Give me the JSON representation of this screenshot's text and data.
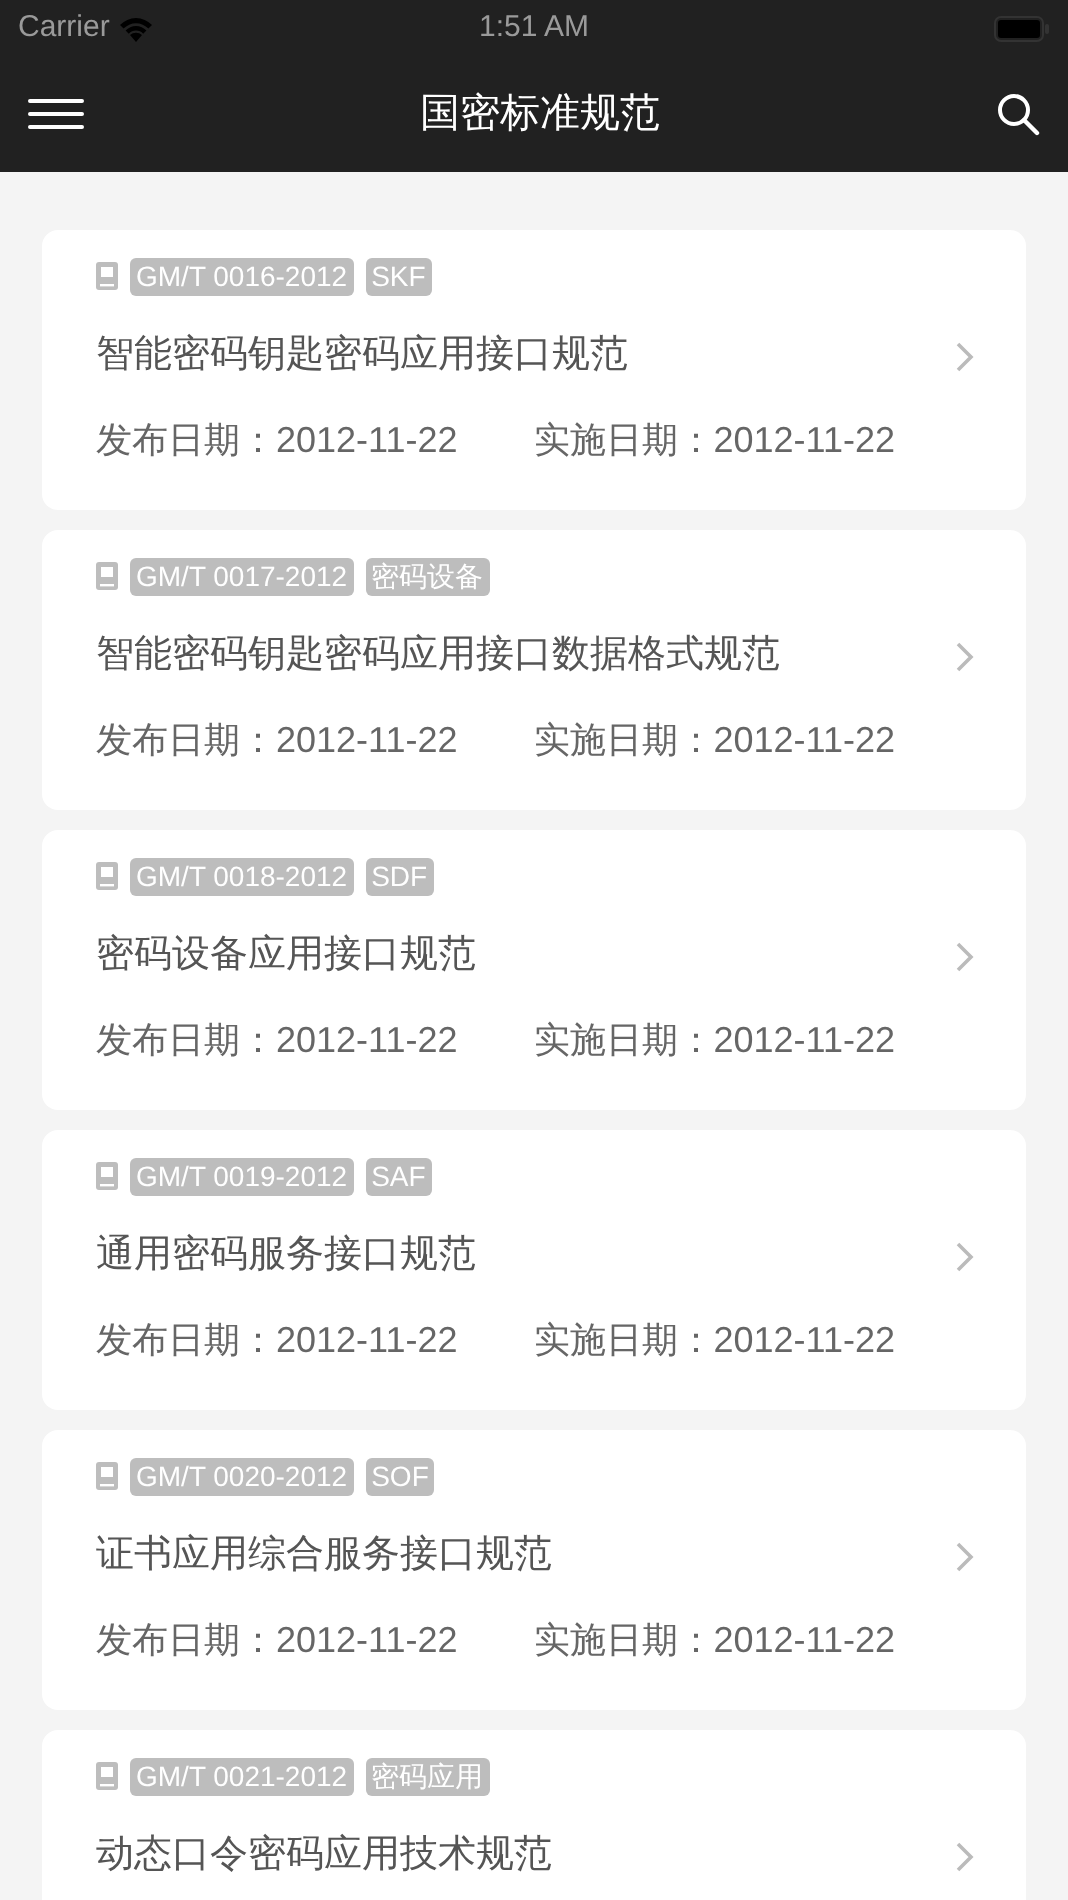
{
  "status_bar": {
    "carrier": "Carrier",
    "time": "1:51 AM"
  },
  "nav": {
    "title": "国密标准规范"
  },
  "items": [
    {
      "code": "GM/T 0016-2012",
      "tag": "SKF",
      "title": "智能密码钥匙密码应用接口规范",
      "published": "发布日期：2012-11-22",
      "effective": "实施日期：2012-11-22"
    },
    {
      "code": "GM/T 0017-2012",
      "tag": "密码设备",
      "title": "智能密码钥匙密码应用接口数据格式规范",
      "published": "发布日期：2012-11-22",
      "effective": "实施日期：2012-11-22"
    },
    {
      "code": "GM/T 0018-2012",
      "tag": "SDF",
      "title": "密码设备应用接口规范",
      "published": "发布日期：2012-11-22",
      "effective": "实施日期：2012-11-22"
    },
    {
      "code": "GM/T 0019-2012",
      "tag": "SAF",
      "title": "通用密码服务接口规范",
      "published": "发布日期：2012-11-22",
      "effective": "实施日期：2012-11-22"
    },
    {
      "code": "GM/T 0020-2012",
      "tag": "SOF",
      "title": "证书应用综合服务接口规范",
      "published": "发布日期：2012-11-22",
      "effective": "实施日期：2012-11-22"
    },
    {
      "code": "GM/T 0021-2012",
      "tag": "密码应用",
      "title": "动态口令密码应用技术规范"
    }
  ]
}
